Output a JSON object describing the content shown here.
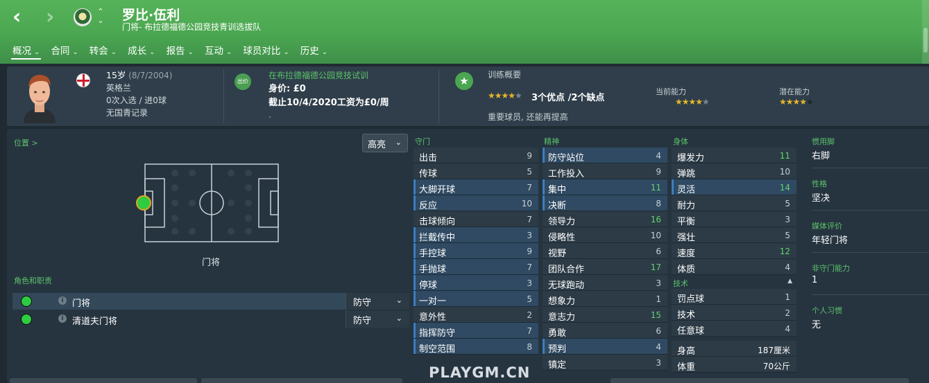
{
  "header": {
    "back_glyph": "‹",
    "forward_glyph": "›",
    "player_name": "罗比·伍利",
    "subtitle": "门将- 布拉德福德公园竞技青训选拔队",
    "tabs": [
      {
        "label": "概况",
        "active": true
      },
      {
        "label": "合同",
        "active": false
      },
      {
        "label": "转会",
        "active": false
      },
      {
        "label": "成长",
        "active": false
      },
      {
        "label": "报告",
        "active": false
      },
      {
        "label": "互动",
        "active": false
      },
      {
        "label": "球员对比",
        "active": false
      },
      {
        "label": "历史",
        "active": false
      }
    ],
    "accent_color": "#4aa650"
  },
  "profile": {
    "age": "15岁",
    "dob": "(8/7/2004)",
    "nationality": "英格兰",
    "caps": "0次入选 / 进0球",
    "youth_record": "无国青记录"
  },
  "contract": {
    "icon_label": "出价",
    "club_trial": "在布拉德福德公园竞技试训",
    "value": "身价: £0",
    "wage": "截止10/4/2020工资为£0/周",
    "dash": "-"
  },
  "training": {
    "title": "训练概要",
    "stars_filled": "★★★★",
    "stars_empty": "★",
    "summary": "3个优点 /2个缺点",
    "note": "重要球员, 还能再提高",
    "current_label": "当前能力",
    "current_stars_filled": "★★★★",
    "current_stars_empty": "★",
    "potential_label": "潜在能力",
    "potential_stars_filled": "★★★★",
    "potential_stars_empty": "★"
  },
  "position": {
    "link": "位置 >",
    "highlight_label": "高亮",
    "pitch_label": "门将"
  },
  "roles": {
    "title": "角色和职责",
    "items": [
      {
        "name": "门将",
        "duty": "防守"
      },
      {
        "name": "清道夫门将",
        "duty": "防守"
      }
    ]
  },
  "attributes": {
    "goalkeeping": {
      "title": "守门",
      "rows": [
        {
          "name": "出击",
          "value": "9",
          "hl": false,
          "good": false
        },
        {
          "name": "传球",
          "value": "5",
          "hl": false,
          "good": false
        },
        {
          "name": "大脚开球",
          "value": "7",
          "hl": true,
          "good": false
        },
        {
          "name": "反应",
          "value": "10",
          "hl": true,
          "good": false
        },
        {
          "name": "击球倾向",
          "value": "7",
          "hl": false,
          "good": false
        },
        {
          "name": "拦截传中",
          "value": "3",
          "hl": true,
          "good": false
        },
        {
          "name": "手控球",
          "value": "9",
          "hl": true,
          "good": false
        },
        {
          "name": "手抛球",
          "value": "7",
          "hl": true,
          "good": false
        },
        {
          "name": "停球",
          "value": "3",
          "hl": true,
          "good": false
        },
        {
          "name": "一对一",
          "value": "5",
          "hl": true,
          "good": false
        },
        {
          "name": "意外性",
          "value": "2",
          "hl": false,
          "good": false
        },
        {
          "name": "指挥防守",
          "value": "7",
          "hl": true,
          "good": false
        },
        {
          "name": "制空范围",
          "value": "8",
          "hl": true,
          "good": false
        }
      ]
    },
    "mental": {
      "title": "精神",
      "rows": [
        {
          "name": "防守站位",
          "value": "4",
          "hl": true,
          "good": false
        },
        {
          "name": "工作投入",
          "value": "9",
          "hl": false,
          "good": false
        },
        {
          "name": "集中",
          "value": "11",
          "hl": true,
          "good": true
        },
        {
          "name": "决断",
          "value": "8",
          "hl": true,
          "good": false
        },
        {
          "name": "领导力",
          "value": "16",
          "hl": false,
          "good": true
        },
        {
          "name": "侵略性",
          "value": "10",
          "hl": false,
          "good": false
        },
        {
          "name": "视野",
          "value": "6",
          "hl": false,
          "good": false
        },
        {
          "name": "团队合作",
          "value": "17",
          "hl": false,
          "good": true
        },
        {
          "name": "无球跑动",
          "value": "3",
          "hl": false,
          "good": false
        },
        {
          "name": "想象力",
          "value": "1",
          "hl": false,
          "good": false
        },
        {
          "name": "意志力",
          "value": "15",
          "hl": false,
          "good": true
        },
        {
          "name": "勇敢",
          "value": "6",
          "hl": false,
          "good": false
        },
        {
          "name": "预判",
          "value": "4",
          "hl": true,
          "good": false
        },
        {
          "name": "镇定",
          "value": "3",
          "hl": false,
          "good": false
        }
      ]
    },
    "physical": {
      "title": "身体",
      "rows": [
        {
          "name": "爆发力",
          "value": "11",
          "hl": false,
          "good": true
        },
        {
          "name": "弹跳",
          "value": "10",
          "hl": false,
          "good": false
        },
        {
          "name": "灵活",
          "value": "14",
          "hl": true,
          "good": true
        },
        {
          "name": "耐力",
          "value": "5",
          "hl": false,
          "good": false
        },
        {
          "name": "平衡",
          "value": "3",
          "hl": false,
          "good": false
        },
        {
          "name": "强壮",
          "value": "5",
          "hl": false,
          "good": false
        },
        {
          "name": "速度",
          "value": "12",
          "hl": false,
          "good": true
        },
        {
          "name": "体质",
          "value": "4",
          "hl": false,
          "good": false
        }
      ]
    },
    "technical": {
      "title": "技术",
      "rows": [
        {
          "name": "罚点球",
          "value": "1",
          "hl": false,
          "good": false
        },
        {
          "name": "技术",
          "value": "2",
          "hl": false,
          "good": false
        },
        {
          "name": "任意球",
          "value": "4",
          "hl": false,
          "good": false
        }
      ]
    },
    "measurements": [
      {
        "name": "身高",
        "value": "187厘米"
      },
      {
        "name": "体重",
        "value": "70公斤"
      }
    ]
  },
  "side_info": [
    {
      "label": "惯用脚",
      "value": "右脚"
    },
    {
      "label": "性格",
      "value": "坚决"
    },
    {
      "label": "媒体评价",
      "value": "年轻门将"
    },
    {
      "label": "非守门能力",
      "value": "1"
    },
    {
      "label": "个人习惯",
      "value": "无"
    }
  ],
  "watermark": "PLAYGM.CN",
  "colors": {
    "good_value": "#63d46e",
    "highlight_row": "#2f4a62",
    "star": "#e7b62c"
  }
}
